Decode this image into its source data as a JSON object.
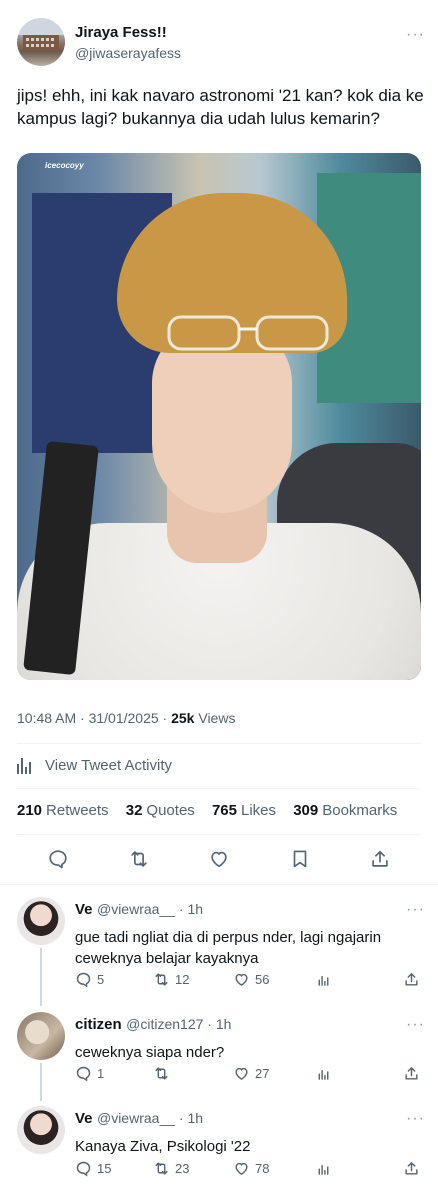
{
  "tweet": {
    "name": "Jiraya Fess!!",
    "handle": "@jiwaserayafess",
    "text": "jips! ehh, ini kak navaro astronomi '21 kan? kok dia ke kampus lagi? bukannya dia udah lulus kemarin?",
    "photo_watermark": "icecocoyy",
    "time": "10:48 AM · 31/01/2025 · ",
    "views_count": "25k",
    "views_label": " Views",
    "activity_label": "View Tweet Activity",
    "stats": [
      {
        "num": "210",
        "label": "Retweets"
      },
      {
        "num": "32",
        "label": "Quotes"
      },
      {
        "num": "765",
        "label": "Likes"
      },
      {
        "num": "309",
        "label": "Bookmarks"
      }
    ]
  },
  "replies": [
    {
      "name": "Ve",
      "handle": "@viewraa__ · 1h",
      "text": "gue tadi ngliat dia di perpus nder, lagi ngajarin ceweknya belajar kayaknya",
      "reply_count": "5",
      "retweet_count": "12",
      "like_count": "56"
    },
    {
      "name": "citizen",
      "handle": "@citizen127 · 1h",
      "text": "ceweknya siapa nder?",
      "reply_count": "1",
      "retweet_count": "",
      "like_count": "27"
    },
    {
      "name": "Ve",
      "handle": "@viewraa__ · 1h",
      "text": "Kanaya Ziva, Psikologi '22",
      "reply_count": "15",
      "retweet_count": "23",
      "like_count": "78"
    }
  ],
  "more_glyph": "···",
  "colors": {
    "text": "#0f1419",
    "secondary": "#536471",
    "divider": "#eff3f4"
  }
}
